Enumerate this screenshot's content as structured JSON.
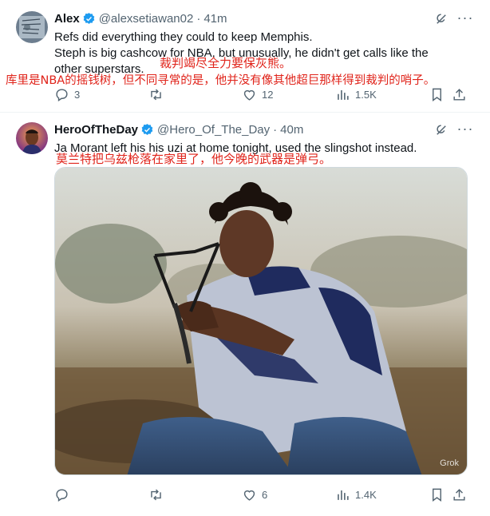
{
  "tweets": [
    {
      "author": {
        "display_name": "Alex",
        "handle": "@alexsetiawan02",
        "time": "41m",
        "verified": true
      },
      "lines": [
        "Refs did everything they could to keep Memphis.",
        "Steph is big cashcow for NBA, but unusually, he didn't get calls like the",
        "other superstars."
      ],
      "translations": [
        "裁判竭尽全力要保灰熊。",
        "库里是NBA的摇钱树，但不同寻常的是，他并没有像其他超巨那样得到裁判的哨子。"
      ],
      "stats": {
        "replies": "3",
        "reposts": "",
        "likes": "12",
        "views": "1.5K"
      }
    },
    {
      "author": {
        "display_name": "HeroOfTheDay",
        "handle": "@Hero_Of_The_Day",
        "time": "40m",
        "verified": true
      },
      "lines": [
        "Ja Morant left his his uzi at home tonight, used the slingshot instead."
      ],
      "translations": [
        "莫兰特把乌兹枪落在家里了，他今晚的武器是弹弓。"
      ],
      "media": {
        "watermark": "Grok"
      },
      "stats": {
        "replies": "",
        "reposts": "",
        "likes": "6",
        "views": "1.4K"
      }
    }
  ],
  "icons": {
    "verified": "verified-badge-icon",
    "grok": "grok-icon",
    "more": "more-icon",
    "reply": "reply-icon",
    "repost": "repost-icon",
    "like": "like-icon",
    "views": "views-icon",
    "bookmark": "bookmark-icon",
    "share": "share-icon"
  },
  "colors": {
    "accent": "#1d9bf0",
    "secondary_text": "#536471",
    "translation": "#e0241b",
    "divider": "#eff3f4"
  }
}
